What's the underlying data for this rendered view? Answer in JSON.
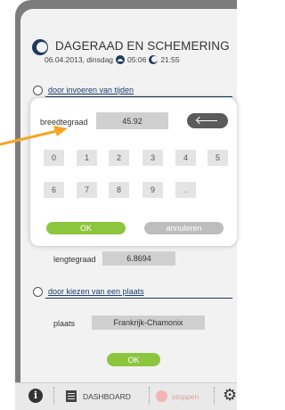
{
  "header": {
    "title": "DAGERAAD EN SCHEMERING",
    "date": "06.04.2013, dinsdag",
    "sunrise_time": "05:06",
    "sunset_time": "21:55"
  },
  "option_times": {
    "label": "door invoeren van tijden"
  },
  "modal": {
    "latitude_label": "breedtegraad",
    "latitude_value": "45.92",
    "keys_row1": [
      "0",
      "1",
      "2",
      "3",
      "4",
      "5"
    ],
    "keys_row2": [
      "6",
      "7",
      "8",
      "9",
      "."
    ],
    "ok_label": "OK",
    "cancel_label": "annuleren"
  },
  "longitude": {
    "label": "lengtegraad",
    "value": "6.8694"
  },
  "option_place": {
    "label": "door kiezen van een plaats"
  },
  "place": {
    "label": "plaats",
    "value": "Frankrijk-Chamonix"
  },
  "ok_button": {
    "label": "OK"
  },
  "bottom_bar": {
    "dashboard_label": "DASHBOARD",
    "stop_label": "stoppen"
  },
  "colors": {
    "accent_green": "#8cc63e",
    "navy": "#1d3a5f",
    "arrow": "#f5a623"
  }
}
